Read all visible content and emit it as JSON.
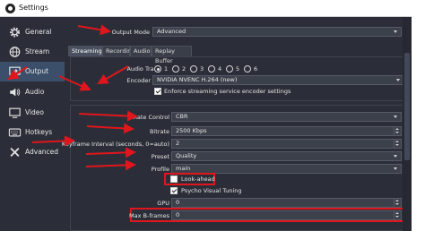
{
  "window": {
    "title": "Settings"
  },
  "sidebar": {
    "items": [
      {
        "label": "General",
        "icon": "gear-icon"
      },
      {
        "label": "Stream",
        "icon": "globe-icon"
      },
      {
        "label": "Output",
        "icon": "monitor-output-icon",
        "active": true
      },
      {
        "label": "Audio",
        "icon": "speaker-icon"
      },
      {
        "label": "Video",
        "icon": "monitor-icon"
      },
      {
        "label": "Hotkeys",
        "icon": "keyboard-icon"
      },
      {
        "label": "Advanced",
        "icon": "wrench-screwdriver-icon"
      }
    ]
  },
  "output_mode": {
    "label": "Output Mode",
    "value": "Advanced"
  },
  "tabs": [
    {
      "label": "Streaming",
      "active": true
    },
    {
      "label": "Recording"
    },
    {
      "label": "Audio"
    },
    {
      "label": "Replay Buffer"
    }
  ],
  "audio_track": {
    "label": "Audio Track",
    "options": [
      "1",
      "2",
      "3",
      "4",
      "5",
      "6"
    ],
    "selected": "1"
  },
  "encoder": {
    "label": "Encoder",
    "value": "NVIDIA NVENC H.264 (new)"
  },
  "enforce": {
    "label": "Enforce streaming service encoder settings",
    "checked": true
  },
  "fields": {
    "rate_control": {
      "label": "Rate Control",
      "value": "CBR"
    },
    "bitrate": {
      "label": "Bitrate",
      "value": "2500 Kbps"
    },
    "keyframe": {
      "label": "Keyframe Interval (seconds, 0=auto)",
      "value": "2"
    },
    "preset": {
      "label": "Preset",
      "value": "Quality"
    },
    "profile": {
      "label": "Profile",
      "value": "main"
    },
    "lookahead": {
      "label": "Look-ahead",
      "checked": false
    },
    "psycho": {
      "label": "Psycho Visual Tuning",
      "checked": true
    },
    "gpu": {
      "label": "GPU",
      "value": "0"
    },
    "bframes": {
      "label": "Max B-frames",
      "value": "0"
    }
  },
  "colors": {
    "highlight": "#e0161c",
    "active_item": "#3b4f6b",
    "background": "#2b2e38"
  }
}
